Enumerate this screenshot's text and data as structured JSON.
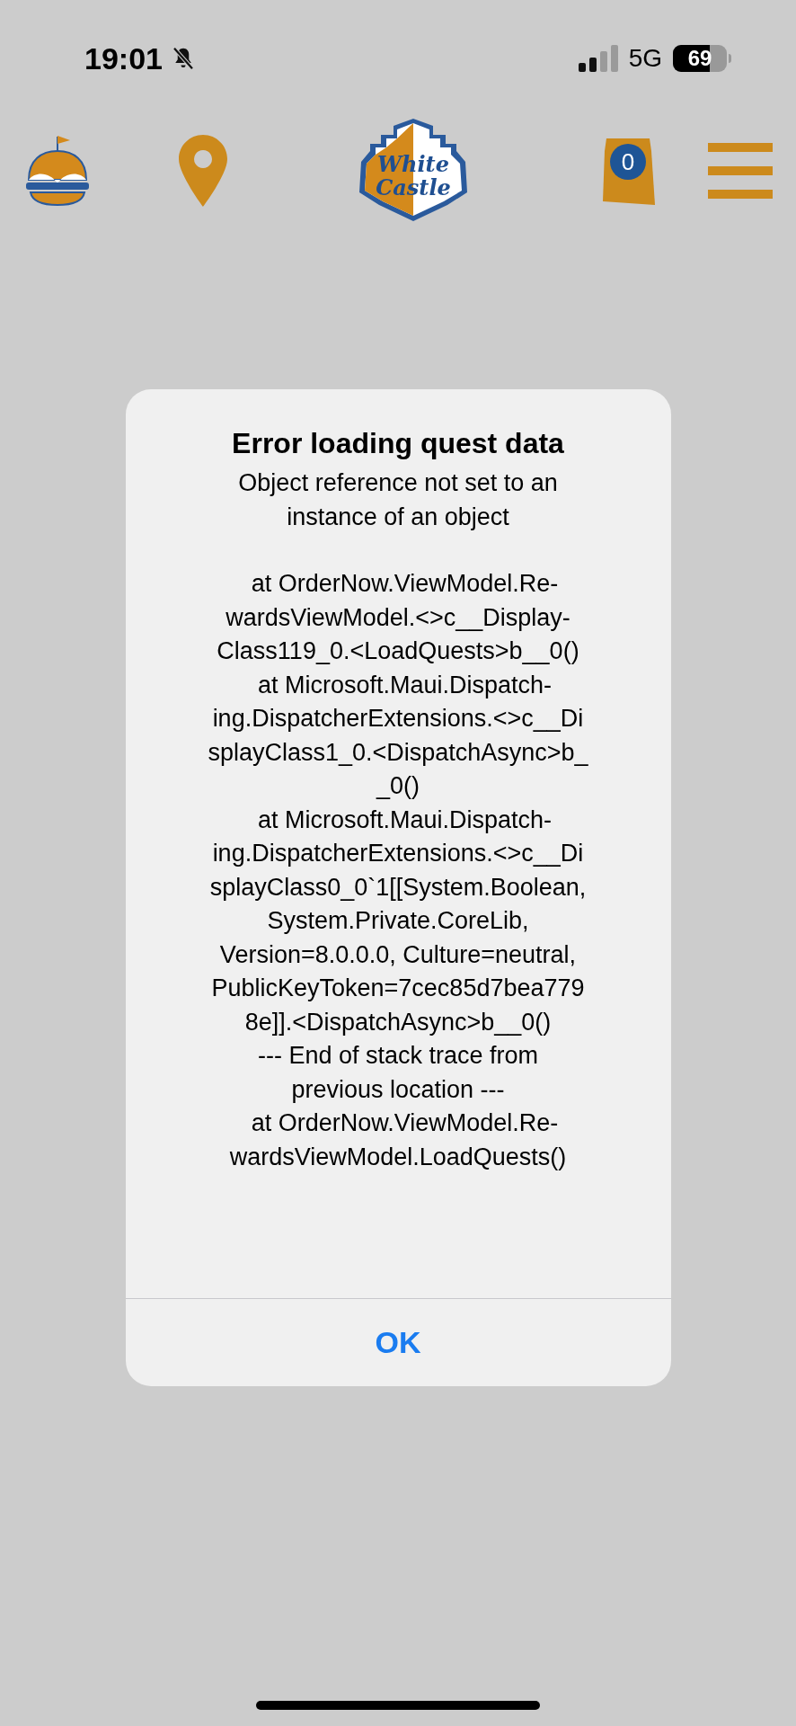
{
  "status_bar": {
    "time": "19:01",
    "network": "5G",
    "battery": "69"
  },
  "header": {
    "logo_lines": [
      "White",
      "Castle"
    ],
    "cart_count": "0"
  },
  "alert": {
    "title": "Error loading quest data",
    "message_lines": [
      "Object reference not set to an",
      "instance of an object"
    ],
    "trace_lines": [
      "  at OrderNow.ViewModel.Re-",
      "wardsViewModel.<>c__Display-",
      "Class119_0.<LoadQuests>b__0()",
      "  at Microsoft.Maui.Dispatch-",
      "ing.DispatcherExtensions.<>c__Di",
      "splayClass1_0.<DispatchAsync>b_",
      "_0()",
      "  at Microsoft.Maui.Dispatch-",
      "ing.DispatcherExtensions.<>c__Di",
      "splayClass0_0`1[[System.Boolean,",
      "System.Private.CoreLib,",
      "Version=8.0.0.0, Culture=neutral,",
      "PublicKeyToken=7cec85d7bea779",
      "8e]].<DispatchAsync>b__0()",
      "--- End of stack trace from",
      "previous location ---",
      "  at OrderNow.ViewModel.Re-",
      "wardsViewModel.LoadQuests()"
    ],
    "button": "OK"
  }
}
